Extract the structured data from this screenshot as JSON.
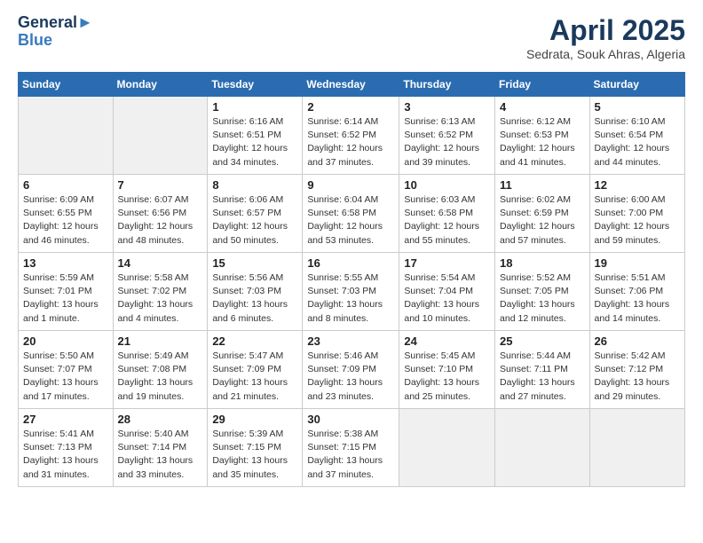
{
  "logo": {
    "line1": "General",
    "line2": "Blue"
  },
  "title": "April 2025",
  "subtitle": "Sedrata, Souk Ahras, Algeria",
  "days_header": [
    "Sunday",
    "Monday",
    "Tuesday",
    "Wednesday",
    "Thursday",
    "Friday",
    "Saturday"
  ],
  "weeks": [
    [
      {
        "num": "",
        "info": ""
      },
      {
        "num": "",
        "info": ""
      },
      {
        "num": "1",
        "info": "Sunrise: 6:16 AM\nSunset: 6:51 PM\nDaylight: 12 hours and 34 minutes."
      },
      {
        "num": "2",
        "info": "Sunrise: 6:14 AM\nSunset: 6:52 PM\nDaylight: 12 hours and 37 minutes."
      },
      {
        "num": "3",
        "info": "Sunrise: 6:13 AM\nSunset: 6:52 PM\nDaylight: 12 hours and 39 minutes."
      },
      {
        "num": "4",
        "info": "Sunrise: 6:12 AM\nSunset: 6:53 PM\nDaylight: 12 hours and 41 minutes."
      },
      {
        "num": "5",
        "info": "Sunrise: 6:10 AM\nSunset: 6:54 PM\nDaylight: 12 hours and 44 minutes."
      }
    ],
    [
      {
        "num": "6",
        "info": "Sunrise: 6:09 AM\nSunset: 6:55 PM\nDaylight: 12 hours and 46 minutes."
      },
      {
        "num": "7",
        "info": "Sunrise: 6:07 AM\nSunset: 6:56 PM\nDaylight: 12 hours and 48 minutes."
      },
      {
        "num": "8",
        "info": "Sunrise: 6:06 AM\nSunset: 6:57 PM\nDaylight: 12 hours and 50 minutes."
      },
      {
        "num": "9",
        "info": "Sunrise: 6:04 AM\nSunset: 6:58 PM\nDaylight: 12 hours and 53 minutes."
      },
      {
        "num": "10",
        "info": "Sunrise: 6:03 AM\nSunset: 6:58 PM\nDaylight: 12 hours and 55 minutes."
      },
      {
        "num": "11",
        "info": "Sunrise: 6:02 AM\nSunset: 6:59 PM\nDaylight: 12 hours and 57 minutes."
      },
      {
        "num": "12",
        "info": "Sunrise: 6:00 AM\nSunset: 7:00 PM\nDaylight: 12 hours and 59 minutes."
      }
    ],
    [
      {
        "num": "13",
        "info": "Sunrise: 5:59 AM\nSunset: 7:01 PM\nDaylight: 13 hours and 1 minute."
      },
      {
        "num": "14",
        "info": "Sunrise: 5:58 AM\nSunset: 7:02 PM\nDaylight: 13 hours and 4 minutes."
      },
      {
        "num": "15",
        "info": "Sunrise: 5:56 AM\nSunset: 7:03 PM\nDaylight: 13 hours and 6 minutes."
      },
      {
        "num": "16",
        "info": "Sunrise: 5:55 AM\nSunset: 7:03 PM\nDaylight: 13 hours and 8 minutes."
      },
      {
        "num": "17",
        "info": "Sunrise: 5:54 AM\nSunset: 7:04 PM\nDaylight: 13 hours and 10 minutes."
      },
      {
        "num": "18",
        "info": "Sunrise: 5:52 AM\nSunset: 7:05 PM\nDaylight: 13 hours and 12 minutes."
      },
      {
        "num": "19",
        "info": "Sunrise: 5:51 AM\nSunset: 7:06 PM\nDaylight: 13 hours and 14 minutes."
      }
    ],
    [
      {
        "num": "20",
        "info": "Sunrise: 5:50 AM\nSunset: 7:07 PM\nDaylight: 13 hours and 17 minutes."
      },
      {
        "num": "21",
        "info": "Sunrise: 5:49 AM\nSunset: 7:08 PM\nDaylight: 13 hours and 19 minutes."
      },
      {
        "num": "22",
        "info": "Sunrise: 5:47 AM\nSunset: 7:09 PM\nDaylight: 13 hours and 21 minutes."
      },
      {
        "num": "23",
        "info": "Sunrise: 5:46 AM\nSunset: 7:09 PM\nDaylight: 13 hours and 23 minutes."
      },
      {
        "num": "24",
        "info": "Sunrise: 5:45 AM\nSunset: 7:10 PM\nDaylight: 13 hours and 25 minutes."
      },
      {
        "num": "25",
        "info": "Sunrise: 5:44 AM\nSunset: 7:11 PM\nDaylight: 13 hours and 27 minutes."
      },
      {
        "num": "26",
        "info": "Sunrise: 5:42 AM\nSunset: 7:12 PM\nDaylight: 13 hours and 29 minutes."
      }
    ],
    [
      {
        "num": "27",
        "info": "Sunrise: 5:41 AM\nSunset: 7:13 PM\nDaylight: 13 hours and 31 minutes."
      },
      {
        "num": "28",
        "info": "Sunrise: 5:40 AM\nSunset: 7:14 PM\nDaylight: 13 hours and 33 minutes."
      },
      {
        "num": "29",
        "info": "Sunrise: 5:39 AM\nSunset: 7:15 PM\nDaylight: 13 hours and 35 minutes."
      },
      {
        "num": "30",
        "info": "Sunrise: 5:38 AM\nSunset: 7:15 PM\nDaylight: 13 hours and 37 minutes."
      },
      {
        "num": "",
        "info": ""
      },
      {
        "num": "",
        "info": ""
      },
      {
        "num": "",
        "info": ""
      }
    ]
  ]
}
